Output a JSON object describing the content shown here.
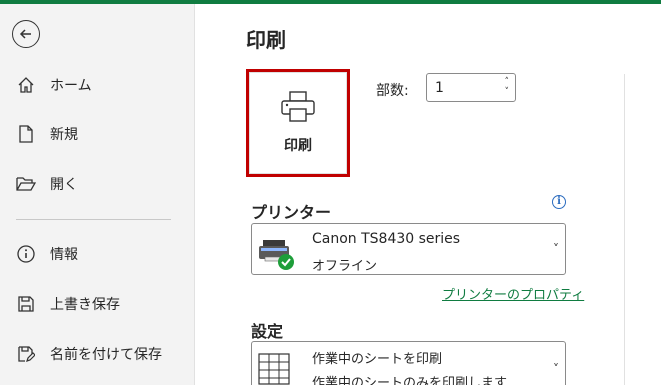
{
  "sidebar": {
    "back_icon": "back-arrow-icon",
    "items": [
      {
        "label": "ホーム",
        "icon": "home-icon"
      },
      {
        "label": "新規",
        "icon": "new-document-icon"
      },
      {
        "label": "開く",
        "icon": "folder-open-icon"
      },
      {
        "label": "情報",
        "icon": "info-icon"
      },
      {
        "label": "上書き保存",
        "icon": "save-icon"
      },
      {
        "label": "名前を付けて保存",
        "icon": "save-as-icon"
      }
    ]
  },
  "main": {
    "title": "印刷",
    "print_button": {
      "label": "印刷",
      "icon": "printer-icon"
    },
    "copies": {
      "label": "部数:",
      "value": "1"
    },
    "printer_section": {
      "heading": "プリンター",
      "selected_printer": "Canon TS8430 series",
      "status": "オフライン",
      "properties_link": "プリンターのプロパティ"
    },
    "settings_section": {
      "heading": "設定",
      "selected": "作業中のシートを印刷",
      "description": "作業中のシートのみを印刷します"
    }
  },
  "colors": {
    "accent": "#107c41",
    "highlight_border": "#c00000",
    "status_ok": "#1e9e3a",
    "info": "#2b6cbf"
  }
}
